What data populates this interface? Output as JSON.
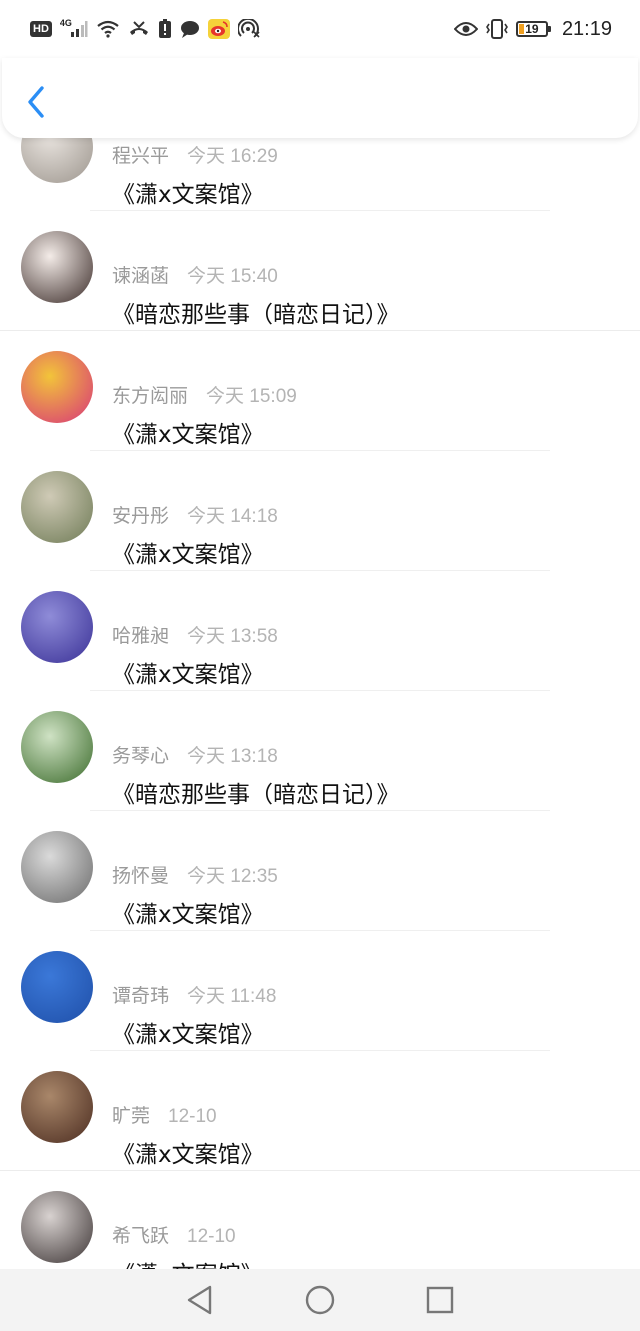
{
  "status_bar": {
    "hd_label": "HD",
    "network_type": "4G",
    "battery_level": "19",
    "time": "21:19",
    "icons": [
      "hd-badge-icon",
      "signal-icon",
      "wifi-icon",
      "missed-call-icon",
      "alert-icon",
      "chat-bubble-icon",
      "weibo-icon",
      "hotspot-icon",
      "eye-icon",
      "vibrate-icon",
      "battery-icon"
    ],
    "accent": "#f0a020"
  },
  "header": {
    "back_icon": "chevron-left-icon",
    "accent_color": "#2b8ef5"
  },
  "messages": [
    {
      "name": "程兴平",
      "time": "今天 16:29",
      "title": "《潇x文案馆》",
      "avatar_colors": [
        "#e9e4df",
        "#9c958d"
      ]
    },
    {
      "name": "谏涵菡",
      "time": "今天 15:40",
      "title": "《暗恋那些事（暗恋日记）》",
      "avatar_colors": [
        "#f4ece8",
        "#3a2b28"
      ]
    },
    {
      "name": "东方闳丽",
      "time": "今天 15:09",
      "title": "《潇x文案馆》",
      "avatar_colors": [
        "#f2c43a",
        "#d8357a"
      ]
    },
    {
      "name": "安丹彤",
      "time": "今天 14:18",
      "title": "《潇x文案馆》",
      "avatar_colors": [
        "#cfcab6",
        "#6e7a55"
      ]
    },
    {
      "name": "哈雅昶",
      "time": "今天 13:58",
      "title": "《潇x文案馆》",
      "avatar_colors": [
        "#8f8cd8",
        "#3a3196"
      ]
    },
    {
      "name": "务琴心",
      "time": "今天 13:18",
      "title": "《暗恋那些事（暗恋日记）》",
      "avatar_colors": [
        "#cfe2c4",
        "#3b6b2b"
      ]
    },
    {
      "name": "扬怀曼",
      "time": "今天 12:35",
      "title": "《潇x文案馆》",
      "avatar_colors": [
        "#dadada",
        "#6a6a6a"
      ]
    },
    {
      "name": "谭奇玮",
      "time": "今天 11:48",
      "title": "《潇x文案馆》",
      "avatar_colors": [
        "#3b78d8",
        "#1f4fa8"
      ]
    },
    {
      "name": "旷莞",
      "time": "12-10",
      "title": "《潇x文案馆》",
      "avatar_colors": [
        "#a9876a",
        "#4b2c20"
      ]
    },
    {
      "name": "希飞跃",
      "time": "12-10",
      "title": "《潇x文案馆》",
      "avatar_colors": [
        "#d8d2d0",
        "#3c3434"
      ]
    }
  ],
  "nav_bar": {
    "back_icon": "triangle-back-icon",
    "home_icon": "circle-home-icon",
    "recents_icon": "square-recents-icon"
  }
}
